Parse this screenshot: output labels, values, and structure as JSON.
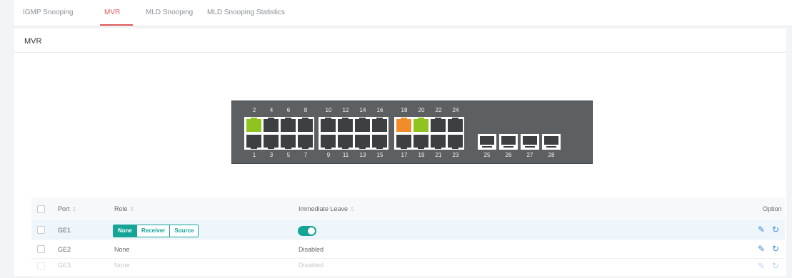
{
  "tabs": [
    "IGMP Snooping",
    "MVR",
    "MLD Snooping",
    "MLD Snooping Statistics"
  ],
  "active_tab": "MVR",
  "card_title": "MVR",
  "switch": {
    "top_labels": [
      "2",
      "4",
      "6",
      "8",
      "10",
      "12",
      "14",
      "16",
      "18",
      "20",
      "22",
      "24"
    ],
    "bottom_labels": [
      "1",
      "3",
      "5",
      "7",
      "9",
      "11",
      "13",
      "15",
      "17",
      "19",
      "21",
      "23"
    ],
    "sfp_labels": [
      "25",
      "26",
      "27",
      "28"
    ],
    "active_ports": {
      "2": "green",
      "18": "orange",
      "20": "green"
    }
  },
  "table": {
    "headers": {
      "port": "Port",
      "role": "Role",
      "immediate_leave": "Immediate Leave",
      "option": "Option"
    },
    "rows": [
      {
        "port": "GE1",
        "role_options": [
          "None",
          "Receiver",
          "Source"
        ],
        "role_selected": "None",
        "immediate_leave": "enabled"
      },
      {
        "port": "GE2",
        "role": "None",
        "immediate_leave": "Disabled"
      },
      {
        "port": "GE3",
        "role": "None",
        "immediate_leave": "Disabled"
      }
    ]
  },
  "icons": {
    "edit": "pencil-icon",
    "reset": "refresh-icon"
  },
  "colors": {
    "accent": "#14a596",
    "tab_active": "#e05a5a",
    "link": "#3d8ed8"
  }
}
